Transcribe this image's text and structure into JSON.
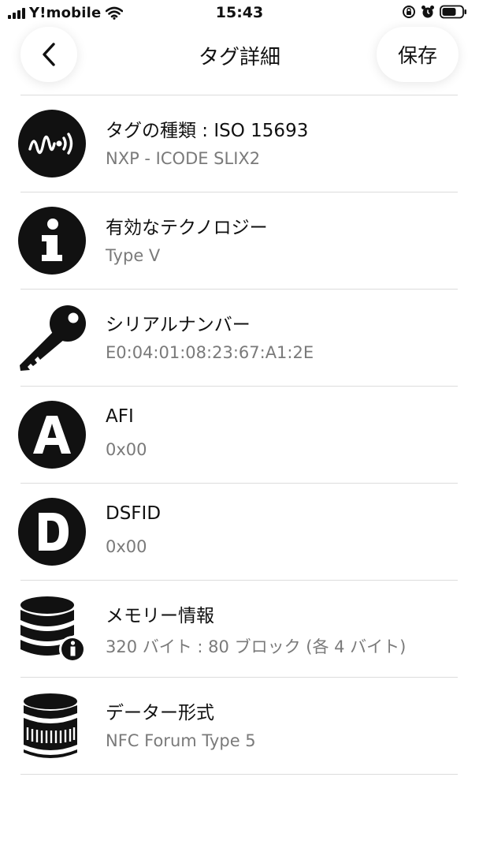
{
  "status_bar": {
    "carrier": "Y!mobile",
    "time": "15:43"
  },
  "nav": {
    "title": "タグ詳細",
    "save_label": "保存"
  },
  "items": [
    {
      "icon": "nfc-signal-icon",
      "title": "タグの種類 : ISO 15693",
      "value": "NXP - ICODE SLIX2"
    },
    {
      "icon": "info-icon",
      "title": "有効なテクノロジー",
      "value": "Type V"
    },
    {
      "icon": "key-icon",
      "title": "シリアルナンバー",
      "value": "E0:04:01:08:23:67:A1:2E"
    },
    {
      "icon": "letter-a-icon",
      "title": "AFI",
      "value": "0x00"
    },
    {
      "icon": "letter-d-icon",
      "title": "DSFID",
      "value": "0x00"
    },
    {
      "icon": "database-info-icon",
      "title": "メモリー情報",
      "value": "320 バイト : 80 ブロック (各 4 バイト)"
    },
    {
      "icon": "database-icon",
      "title": "データー形式",
      "value": "NFC Forum Type 5"
    }
  ],
  "colors": {
    "text": "#111111",
    "subtext": "#7a7a7a",
    "divider": "#dcdcdc",
    "background": "#ffffff"
  }
}
